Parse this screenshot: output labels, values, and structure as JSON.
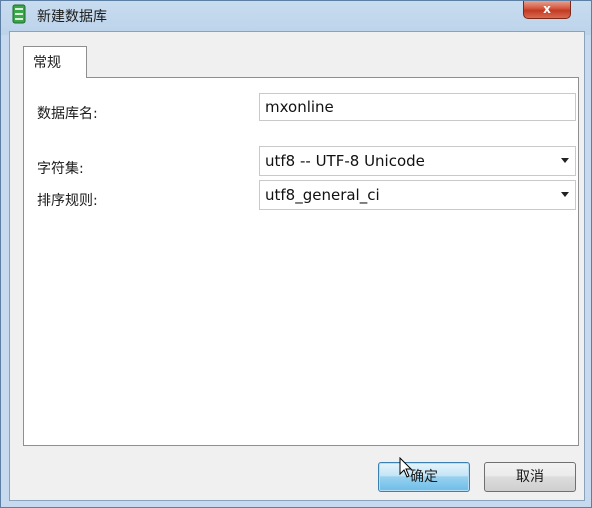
{
  "window": {
    "title": "新建数据库",
    "close_glyph": "x"
  },
  "tabs": [
    {
      "label": "常规",
      "selected": true
    }
  ],
  "form": {
    "db_name": {
      "label": "数据库名:",
      "value": "mxonline"
    },
    "charset": {
      "label": "字符集:",
      "value": "utf8 -- UTF-8 Unicode"
    },
    "collation": {
      "label": "排序规则:",
      "value": "utf8_general_ci"
    }
  },
  "buttons": {
    "ok": "确定",
    "cancel": "取消"
  },
  "icons": {
    "app": "database-icon",
    "close": "close-icon",
    "dropdown": "chevron-down-icon",
    "cursor": "mouse-cursor-icon"
  },
  "colors": {
    "title_bar": "#bcd3ea",
    "close_button": "#c23a22",
    "primary_button": "#98d1ef",
    "app_icon": "#3aa64a"
  }
}
